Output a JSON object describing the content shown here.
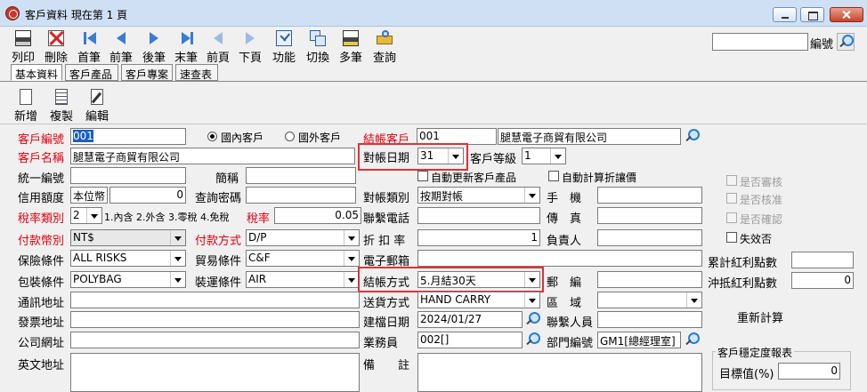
{
  "window": {
    "title": "客戶資料 現在第 1 頁"
  },
  "toolbar": {
    "buttons": [
      {
        "label": "列印",
        "icon": "printer-icon"
      },
      {
        "label": "刪除",
        "icon": "delete-icon"
      },
      {
        "label": "首筆",
        "icon": "first-record-icon"
      },
      {
        "label": "前筆",
        "icon": "previous-record-icon"
      },
      {
        "label": "後筆",
        "icon": "next-record-icon"
      },
      {
        "label": "末筆",
        "icon": "last-record-icon"
      },
      {
        "label": "前頁",
        "icon": "previous-page-icon"
      },
      {
        "label": "下頁",
        "icon": "next-page-icon"
      },
      {
        "label": "功能",
        "icon": "function-icon"
      },
      {
        "label": "切換",
        "icon": "switch-icon"
      },
      {
        "label": "多筆",
        "icon": "multi-record-icon"
      },
      {
        "label": "查詢",
        "icon": "query-icon"
      }
    ],
    "search_label": "編號",
    "search_value": ""
  },
  "tabs": [
    "基本資料",
    "客戶產品",
    "客戶專案",
    "速查表"
  ],
  "subtoolbar": {
    "new": "新增",
    "copy": "複製",
    "edit": "編輯"
  },
  "form": {
    "customer_no_label": "客戶編號",
    "customer_no": "001",
    "domestic": "國內客戶",
    "foreign": "國外客戶",
    "billing_customer_label": "結帳客戶",
    "billing_customer_no": "001",
    "billing_customer_name": "腿慧電子商貿有限公司",
    "customer_name_label": "客戶名稱",
    "customer_name": "腿慧電子商貿有限公司",
    "recon_date_label": "對帳日期",
    "recon_date": "31",
    "customer_level_label": "客戶等級",
    "customer_level": "1",
    "auto_update_label": "自動更新客戶產品",
    "auto_discount_label": "自動計算折讓價",
    "tax_id_label": "統一編號",
    "tax_id": "",
    "short_name_label": "簡稱",
    "short_name": "",
    "credit_label": "信用額度",
    "credit_currency": "本位幣",
    "credit_value": "0",
    "query_pwd_label": "查詢密碼",
    "query_pwd": "",
    "recon_type_label": "對帳類別",
    "recon_type": "按期對帳",
    "mobile_label": "手　機",
    "mobile": "",
    "tax_type_label": "稅率類別",
    "tax_type": "2",
    "tax_type_desc": "1.內含 2.外含 3.零稅 4.免稅",
    "tax_rate_label": "稅率",
    "tax_rate": "0.05",
    "contact_phone_label": "聯繫電話",
    "contact_phone": "",
    "fax_label": "傳　真",
    "fax": "",
    "currency_label": "付款幣別",
    "currency": "NT$",
    "payment_label": "付款方式",
    "payment": "D/P",
    "discount_label": "折 扣 率",
    "discount": "1",
    "owner_label": "負責人",
    "owner": "",
    "email_label": "電子郵箱",
    "email": "",
    "insurance_label": "保險條件",
    "insurance": "ALL RISKS",
    "trade_label": "貿易條件",
    "trade": "C&F",
    "packing_label": "包裝條件",
    "packing": "POLYBAG",
    "shipping_label": "裝運條件",
    "shipping": "AIR",
    "settle_label": "結帳方式",
    "settle": "5.月結30天",
    "postal_label": "郵　編",
    "postal": "",
    "comm_addr_label": "通訊地址",
    "comm_addr": "",
    "delivery_label": "送貨方式",
    "delivery": "HAND CARRY",
    "region_label": "區　域",
    "region": "",
    "invoice_addr_label": "發票地址",
    "invoice_addr": "",
    "created_label": "建檔日期",
    "created": "2024/01/27",
    "contact_label": "聯繫人員",
    "contact": "",
    "website_label": "公司網址",
    "website": "",
    "salesman_label": "業務員",
    "salesman": "002[]",
    "dept_label": "部門編號",
    "dept": "GM1[總經理室]",
    "en_addr_label": "英文地址",
    "en_addr": "",
    "note_label": "備　　註",
    "note": ""
  },
  "right_panel": {
    "audited": "是否審核",
    "approved": "是否核准",
    "confirmed": "是否確認",
    "invalid": "失效否",
    "bonus_total_label": "累計紅利點數",
    "bonus_total": "",
    "bonus_offset_label": "沖抵紅利點數",
    "bonus_offset": "0",
    "recalc": "重新計算",
    "report_title": "客戶穩定度報表",
    "target_label": "目標值(%)",
    "target": "0"
  }
}
